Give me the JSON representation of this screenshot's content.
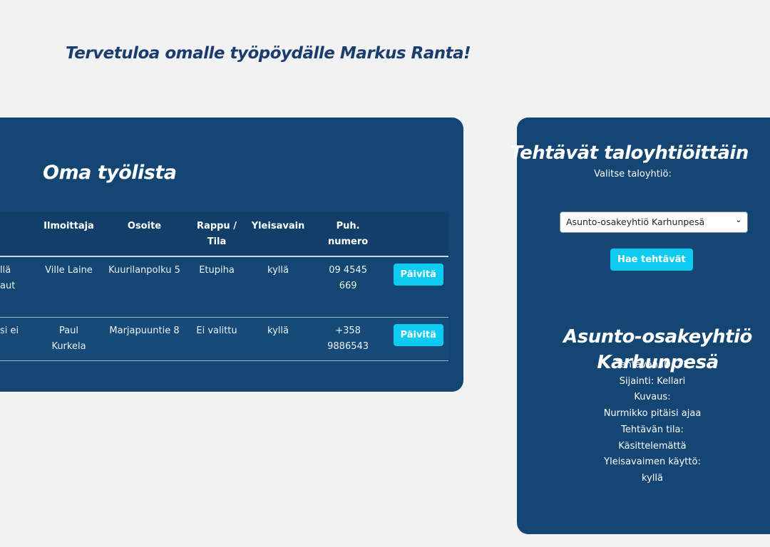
{
  "welcome": "Tervetuloa omalle työpöydälle Markus Ranta!",
  "worklist": {
    "title": "Oma työlista",
    "headers": [
      "Ilmoittaja",
      "Osoite",
      "Rappu / Tila",
      "Yleisavain",
      "Puh. numero"
    ],
    "rows": [
      {
        "partial": "llä\naut",
        "ilmoittaja": "Ville Laine",
        "osoite": "Kuurilanpolku 5",
        "rappu": "Etupiha",
        "yleisavain": "kyllä",
        "puh": "09 4545 669",
        "button": "Päivitä"
      },
      {
        "partial": "si ei",
        "ilmoittaja": "Paul Kurkela",
        "osoite": "Marjapuuntie 8",
        "rappu": "Ei valittu",
        "yleisavain": "kyllä",
        "puh": "+358 9886543",
        "button": "Päivitä"
      }
    ]
  },
  "byHousing": {
    "title": "Tehtävät taloyhtiöittäin",
    "select_label": "Valitse taloyhtiö:",
    "selected": "Asunto-osakeyhtiö Karhunpesä",
    "fetch_button": "Hae tehtävät",
    "result_title": "Asunto-osakeyhtiö Karhunpesä",
    "task": [
      "Tehtävän ID: 31",
      "Sijainti: Kellari",
      "Kuvaus:",
      "Nurmikko pitäisi ajaa",
      "Tehtävän tila:",
      "Käsittelemättä",
      "Yleisavaimen käyttö:",
      "kyllä"
    ]
  }
}
